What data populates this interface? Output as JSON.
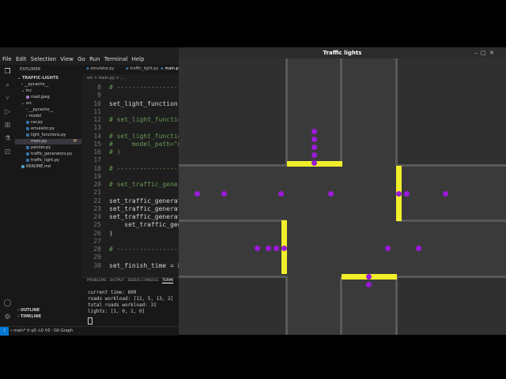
{
  "vscode": {
    "menu": [
      "File",
      "Edit",
      "Selection",
      "View",
      "Go",
      "Run",
      "Terminal",
      "Help"
    ],
    "explorer_title": "EXPLORER",
    "project_name": "TRAFFIC-LIGHTS",
    "tree": [
      {
        "label": "__pycache__",
        "kind": "folder"
      },
      {
        "label": "inc",
        "kind": "folder"
      },
      {
        "label": "road.jpeg",
        "kind": "image"
      },
      {
        "label": "src",
        "kind": "folder"
      },
      {
        "label": "__pycache__",
        "kind": "folder"
      },
      {
        "label": "model",
        "kind": "folder"
      },
      {
        "label": "car.py",
        "kind": "py"
      },
      {
        "label": "emulator.py",
        "kind": "py"
      },
      {
        "label": "light_functions.py",
        "kind": "py"
      },
      {
        "label": "main.py",
        "kind": "py"
      },
      {
        "label": "painter.py",
        "kind": "py"
      },
      {
        "label": "traffic_generators.py",
        "kind": "py"
      },
      {
        "label": "traffic_light.py",
        "kind": "py"
      },
      {
        "label": "README.md",
        "kind": "md"
      }
    ],
    "main_badge": "M",
    "outline_label": "OUTLINE",
    "timeline_label": "TIMELINE",
    "tabs": [
      "emulator.py",
      "traffic_light.py",
      "main.py"
    ],
    "breadcrumb": "src > main.py > ...",
    "code_lines": [
      {
        "n": "8",
        "t": "# ----------------",
        "c": "comment"
      },
      {
        "n": "9",
        "t": "",
        "c": "plain"
      },
      {
        "n": "10",
        "t": "set_light_function",
        "c": "plain"
      },
      {
        "n": "11",
        "t": "",
        "c": "plain"
      },
      {
        "n": "12",
        "t": "# set_light_function",
        "c": "comment"
      },
      {
        "n": "13",
        "t": "",
        "c": "plain"
      },
      {
        "n": "14",
        "t": "# set_light_functio",
        "c": "comment"
      },
      {
        "n": "15",
        "t": "#     model_path=\"m",
        "c": "comment"
      },
      {
        "n": "16",
        "t": "# )",
        "c": "comment"
      },
      {
        "n": "17",
        "t": "",
        "c": "plain"
      },
      {
        "n": "18",
        "t": "# ----------------",
        "c": "comment"
      },
      {
        "n": "19",
        "t": "",
        "c": "plain"
      },
      {
        "n": "20",
        "t": "# set_traffic_gener",
        "c": "comment"
      },
      {
        "n": "21",
        "t": "",
        "c": "plain"
      },
      {
        "n": "22",
        "t": "set_traffic_generat",
        "c": "plain"
      },
      {
        "n": "23",
        "t": "set_traffic_generat",
        "c": "plain"
      },
      {
        "n": "24",
        "t": "set_traffic_generat",
        "c": "plain"
      },
      {
        "n": "25",
        "t": "    set_traffic_gen",
        "c": "plain"
      },
      {
        "n": "26",
        "t": ")",
        "c": "plain"
      },
      {
        "n": "27",
        "t": "",
        "c": "plain"
      },
      {
        "n": "28",
        "t": "# ----------------",
        "c": "comment"
      },
      {
        "n": "29",
        "t": "",
        "c": "plain"
      },
      {
        "n": "30",
        "t": "set_finish_time = 8",
        "c": "plain"
      }
    ],
    "panel_tabs": [
      "PROBLEMS",
      "OUTPUT",
      "DEBUG CONSOLE",
      "TERMI"
    ],
    "terminal_lines": [
      "current time: 600",
      "roads workload: [11, 5, 13, 2]",
      "total roads workload: 31",
      "lights: [1, 0, 1, 0]"
    ],
    "status": {
      "branch": "main*",
      "errors": "0",
      "warnings": "0",
      "ports": "0",
      "git_graph": "Git Graph"
    }
  },
  "traffic_window": {
    "title": "Traffic lights",
    "minimize": "–",
    "maximize": "□",
    "close": "✕"
  },
  "colors": {
    "car": "#9b19d9",
    "light_green_state": "#f2ef2a",
    "road": "#3a3a3a",
    "block": "#303030",
    "curb": "#595959"
  },
  "icons": [
    "files-icon",
    "search-icon",
    "source-control-icon",
    "run-debug-icon",
    "extensions-icon",
    "testing-icon",
    "remote-icon",
    "account-icon",
    "gear-icon"
  ]
}
